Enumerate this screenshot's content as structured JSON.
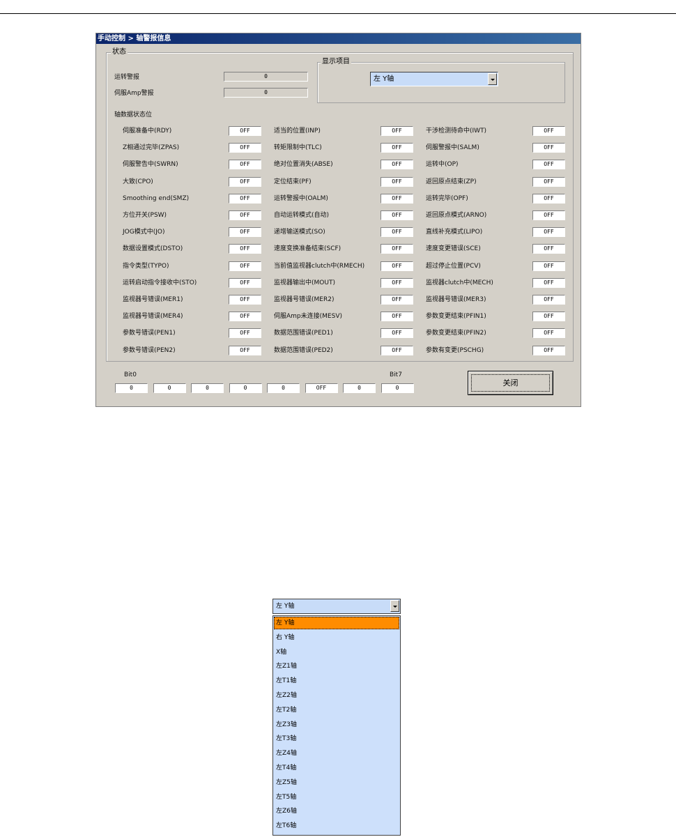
{
  "window": {
    "title": "手动控制 > 轴警报信息",
    "status_group": "状态",
    "display_group": "显示项目",
    "run_alarm_label": "运转警报",
    "run_alarm_value": "0",
    "amp_alarm_label": "伺服Amp警报",
    "amp_alarm_value": "0",
    "axis_selector_value": "左 Y轴",
    "status_bits_title": "轴数据状态位",
    "close_label": "关闭"
  },
  "status_rows": [
    [
      {
        "label": "伺服准备中(RDY)",
        "value": "OFF"
      },
      {
        "label": "适当的位置(INP)",
        "value": "OFF"
      },
      {
        "label": "干涉检测待命中(IWT)",
        "value": "OFF"
      }
    ],
    [
      {
        "label": "Z相通过完毕(ZPAS)",
        "value": "OFF"
      },
      {
        "label": "转矩限制中(TLC)",
        "value": "OFF"
      },
      {
        "label": "伺服警报中(SALM)",
        "value": "OFF"
      }
    ],
    [
      {
        "label": "伺服警告中(SWRN)",
        "value": "OFF"
      },
      {
        "label": "绝对位置消失(ABSE)",
        "value": "OFF"
      },
      {
        "label": "运转中(OP)",
        "value": "OFF"
      }
    ],
    [
      {
        "label": "大致(CPO)",
        "value": "OFF"
      },
      {
        "label": "定位结束(PF)",
        "value": "OFF"
      },
      {
        "label": "返回原点结束(ZP)",
        "value": "OFF"
      }
    ],
    [
      {
        "label": "Smoothing end(SMZ)",
        "value": "OFF"
      },
      {
        "label": "运转警报中(OALM)",
        "value": "OFF"
      },
      {
        "label": "运转完毕(OPF)",
        "value": "OFF"
      }
    ],
    [
      {
        "label": "方位开关(PSW)",
        "value": "OFF"
      },
      {
        "label": "自动运转模式(自动)",
        "value": "OFF"
      },
      {
        "label": "返回原点模式(ARNO)",
        "value": "OFF"
      }
    ],
    [
      {
        "label": "JOG模式中(JO)",
        "value": "OFF"
      },
      {
        "label": "递增输送模式(SO)",
        "value": "OFF"
      },
      {
        "label": "直线补充模式(LIPO)",
        "value": "OFF"
      }
    ],
    [
      {
        "label": "数据设置模式(DSTO)",
        "value": "OFF"
      },
      {
        "label": "速度变换准备结束(SCF)",
        "value": "OFF"
      },
      {
        "label": "速度变更错误(SCE)",
        "value": "OFF"
      }
    ],
    [
      {
        "label": "指令类型(TYPO)",
        "value": "OFF"
      },
      {
        "label": "当前值监视器clutch中(RMECH)",
        "value": "OFF"
      },
      {
        "label": "超过停止位置(PCV)",
        "value": "OFF"
      }
    ],
    [
      {
        "label": "运转启动指令接收中(STO)",
        "value": "OFF"
      },
      {
        "label": "监视器输出中(MOUT)",
        "value": "OFF"
      },
      {
        "label": "监视器clutch中(MECH)",
        "value": "OFF"
      }
    ],
    [
      {
        "label": "监视器号错误(MER1)",
        "value": "OFF"
      },
      {
        "label": "监视器号错误(MER2)",
        "value": "OFF"
      },
      {
        "label": "监视器号错误(MER3)",
        "value": "OFF"
      }
    ],
    [
      {
        "label": "监视器号错误(MER4)",
        "value": "OFF"
      },
      {
        "label": "伺服Amp未连接(MESV)",
        "value": "OFF"
      },
      {
        "label": "参数变更结束(PFIN1)",
        "value": "OFF"
      }
    ],
    [
      {
        "label": "参数号错误(PEN1)",
        "value": "OFF"
      },
      {
        "label": "数据范围错误(PED1)",
        "value": "OFF"
      },
      {
        "label": "参数变更结束(PFIN2)",
        "value": "OFF"
      }
    ],
    [
      {
        "label": "参数号错误(PEN2)",
        "value": "OFF"
      },
      {
        "label": "数据范围错误(PED2)",
        "value": "OFF"
      },
      {
        "label": "参数有变更(PSCHG)",
        "value": "OFF"
      }
    ]
  ],
  "bits": {
    "start_label": "Bit0",
    "end_label": "Bit7",
    "values": [
      "0",
      "0",
      "0",
      "0",
      "0",
      "OFF",
      "0",
      "0"
    ]
  },
  "dropdown": {
    "current": "左 Y轴",
    "items": [
      "左 Y轴",
      "右 Y轴",
      "X轴",
      "左Z1轴",
      "左T1轴",
      "左Z2轴",
      "左T2轴",
      "左Z3轴",
      "左T3轴",
      "左Z4轴",
      "左T4轴",
      "左Z5轴",
      "左T5轴",
      "左Z6轴",
      "左T6轴"
    ],
    "selected_index": 0
  }
}
